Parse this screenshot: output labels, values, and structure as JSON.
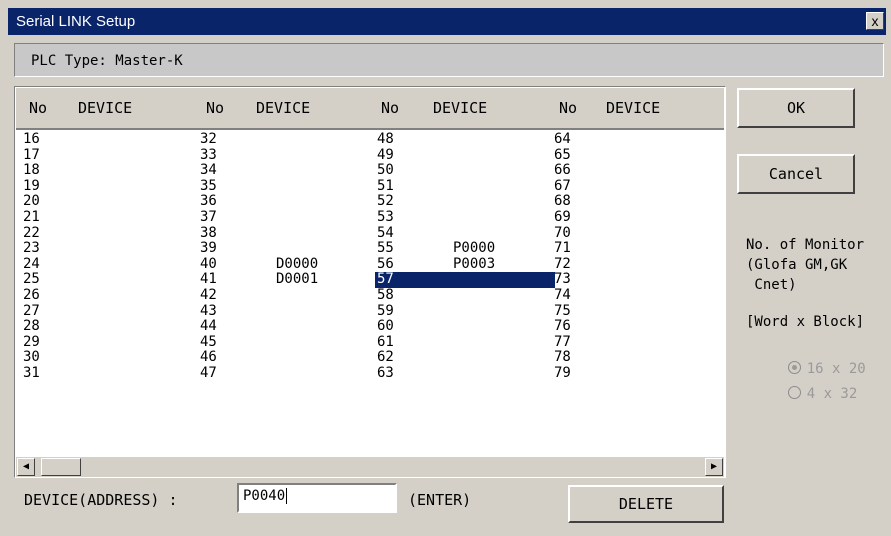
{
  "window": {
    "title": "Serial LINK Setup",
    "close_glyph": "x"
  },
  "plc_type": "PLC Type: Master-K",
  "table": {
    "headers": [
      "No",
      "DEVICE",
      "No",
      "DEVICE",
      "No",
      "DEVICE",
      "No",
      "DEVICE"
    ],
    "columns": [
      {
        "rows": [
          {
            "no": "16",
            "device": ""
          },
          {
            "no": "17",
            "device": ""
          },
          {
            "no": "18",
            "device": ""
          },
          {
            "no": "19",
            "device": ""
          },
          {
            "no": "20",
            "device": ""
          },
          {
            "no": "21",
            "device": ""
          },
          {
            "no": "22",
            "device": ""
          },
          {
            "no": "23",
            "device": ""
          },
          {
            "no": "24",
            "device": ""
          },
          {
            "no": "25",
            "device": ""
          },
          {
            "no": "26",
            "device": ""
          },
          {
            "no": "27",
            "device": ""
          },
          {
            "no": "28",
            "device": ""
          },
          {
            "no": "29",
            "device": ""
          },
          {
            "no": "30",
            "device": ""
          },
          {
            "no": "31",
            "device": ""
          }
        ]
      },
      {
        "rows": [
          {
            "no": "32",
            "device": ""
          },
          {
            "no": "33",
            "device": ""
          },
          {
            "no": "34",
            "device": ""
          },
          {
            "no": "35",
            "device": ""
          },
          {
            "no": "36",
            "device": ""
          },
          {
            "no": "37",
            "device": ""
          },
          {
            "no": "38",
            "device": ""
          },
          {
            "no": "39",
            "device": ""
          },
          {
            "no": "40",
            "device": "D0000"
          },
          {
            "no": "41",
            "device": "D0001"
          },
          {
            "no": "42",
            "device": ""
          },
          {
            "no": "43",
            "device": ""
          },
          {
            "no": "44",
            "device": ""
          },
          {
            "no": "45",
            "device": ""
          },
          {
            "no": "46",
            "device": ""
          },
          {
            "no": "47",
            "device": ""
          }
        ]
      },
      {
        "rows": [
          {
            "no": "48",
            "device": ""
          },
          {
            "no": "49",
            "device": ""
          },
          {
            "no": "50",
            "device": ""
          },
          {
            "no": "51",
            "device": ""
          },
          {
            "no": "52",
            "device": ""
          },
          {
            "no": "53",
            "device": ""
          },
          {
            "no": "54",
            "device": ""
          },
          {
            "no": "55",
            "device": "P0000"
          },
          {
            "no": "56",
            "device": "P0003"
          },
          {
            "no": "57",
            "device": "",
            "selected": true
          },
          {
            "no": "58",
            "device": ""
          },
          {
            "no": "59",
            "device": ""
          },
          {
            "no": "60",
            "device": ""
          },
          {
            "no": "61",
            "device": ""
          },
          {
            "no": "62",
            "device": ""
          },
          {
            "no": "63",
            "device": ""
          }
        ]
      },
      {
        "rows": [
          {
            "no": "64",
            "device": ""
          },
          {
            "no": "65",
            "device": ""
          },
          {
            "no": "66",
            "device": ""
          },
          {
            "no": "67",
            "device": ""
          },
          {
            "no": "68",
            "device": ""
          },
          {
            "no": "69",
            "device": ""
          },
          {
            "no": "70",
            "device": ""
          },
          {
            "no": "71",
            "device": ""
          },
          {
            "no": "72",
            "device": ""
          },
          {
            "no": "73",
            "device": ""
          },
          {
            "no": "74",
            "device": ""
          },
          {
            "no": "75",
            "device": ""
          },
          {
            "no": "76",
            "device": ""
          },
          {
            "no": "77",
            "device": ""
          },
          {
            "no": "78",
            "device": ""
          },
          {
            "no": "79",
            "device": ""
          }
        ]
      }
    ]
  },
  "scrollbar": {
    "left_arrow": "◀",
    "right_arrow": "▶"
  },
  "device_field": {
    "label": "DEVICE(ADDRESS) :",
    "value": "P0040",
    "hint": "(ENTER)"
  },
  "buttons": {
    "ok": "OK",
    "cancel": "Cancel",
    "delete": "DELETE"
  },
  "monitor": {
    "line1": "No. of Monitor",
    "line2": "(Glofa GM,GK",
    "line3": " Cnet)",
    "word_block": "[Word x Block]",
    "options": [
      {
        "label": "16 x 20",
        "selected": true
      },
      {
        "label": "4 x 32",
        "selected": false
      }
    ]
  }
}
